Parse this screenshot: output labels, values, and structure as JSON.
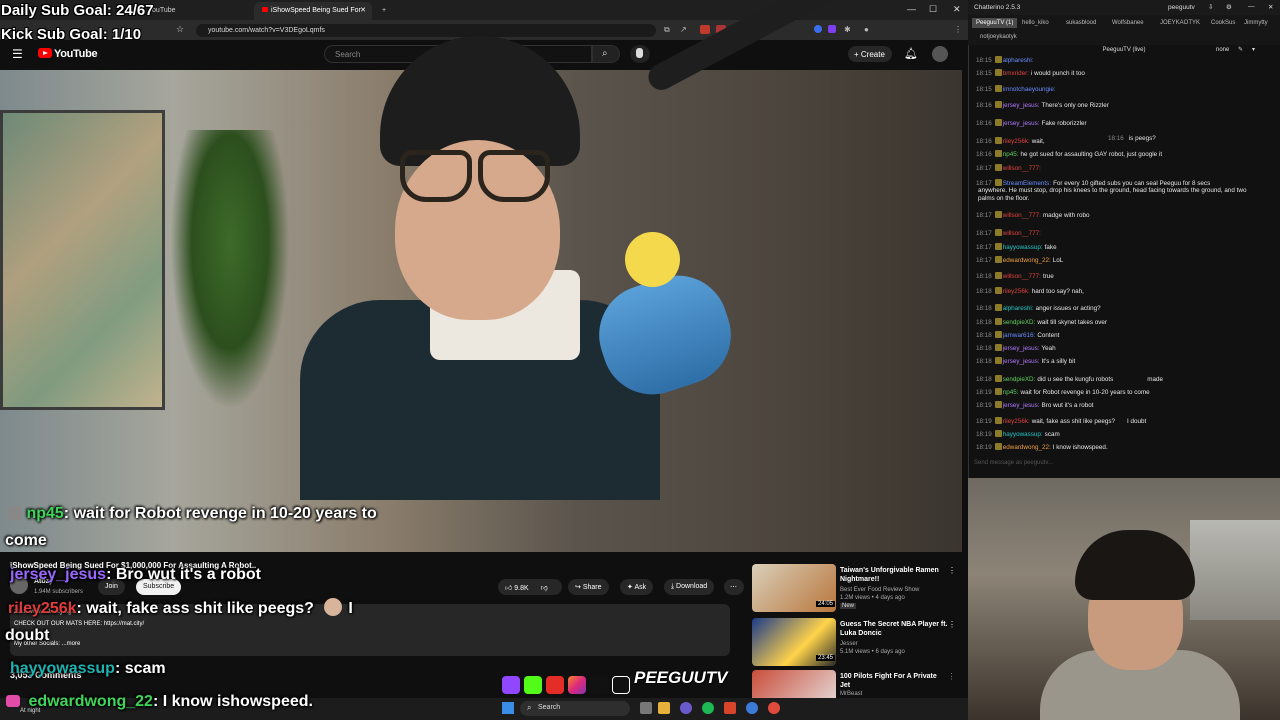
{
  "goals": {
    "daily": "Daily Sub Goal: 24/67",
    "kick": "Kick Sub Goal: 1/10"
  },
  "browser": {
    "tabs": [
      "YouTube",
      "iShowSpeed Being Sued For"
    ],
    "url": "youtube.com/watch?v=V3DEgoLqmfs",
    "window_controls": [
      "—",
      "☐",
      "✕"
    ]
  },
  "youtube": {
    "logo": "YouTube",
    "search_placeholder": "Search",
    "create_label": "Create",
    "video_title": "iShowSpeed Being Sued For $1,000,000 For Assaulting A Robot..",
    "channel": "Atozy",
    "subscribers": "1.94M subscribers",
    "join_label": "Join",
    "subscribe_label": "Subscribe",
    "likes": "9.8K",
    "share_label": "Share",
    "ask_label": "Ask",
    "download_label": "Download",
    "desc_views": "211K views  1 day ago",
    "desc_line": "CHECK OUT OUR MATS HERE: https://mat.city/",
    "desc_more": "My other Socials:  ...more",
    "comments": "3,053 Comments",
    "recommended": [
      {
        "title": "Taiwan's Unforgivable Ramen Nightmare!!",
        "channel": "Best Ever Food Review Show",
        "meta": "1.2M views • 4 days ago",
        "badge": "New",
        "duration": "24:05"
      },
      {
        "title": "Guess The Secret NBA Player ft. Luka Doncic",
        "channel": "Jesser",
        "meta": "5.1M views • 6 days ago",
        "duration": "23:45"
      },
      {
        "title": "100 Pilots Fight For A Private Jet",
        "channel": "MrBeast",
        "meta": "",
        "duration": ""
      }
    ]
  },
  "overlay_chat": [
    {
      "user": "np45",
      "msg": ": wait for Robot revenge in 10-20 years to",
      "cont": "come"
    },
    {
      "user": "jersey_jesus",
      "msg": ": Bro wut it's a robot"
    },
    {
      "user": "riley256k",
      "msg": ": wait, fake ass shit like peegs?",
      "cont": "doubt",
      "tail": "I"
    },
    {
      "user": "hayyowassup",
      "msg": ": scam"
    },
    {
      "user": "edwardwong_22",
      "msg": ": I know ishowspeed."
    }
  ],
  "taskbar": {
    "search": "Search",
    "left_text": "At night"
  },
  "chatterino": {
    "title": "Chatterino 2.5.3",
    "account": "peeguutv",
    "tabs": [
      "PeeguuTV (1)",
      "hello_kiko",
      "sukasblood",
      "Wolfsbanee",
      "JOEYKAOTYK",
      "CookSus",
      "Jimmytty",
      "notjoeykaotyk"
    ],
    "channel_header": "PeeguuTV (live)",
    "mode": "none",
    "input_placeholder": "Send message as peeguutv...",
    "messages": [
      {
        "time": "18:15",
        "user": "alphareshi:",
        "text": "",
        "color": "n-blue"
      },
      {
        "time": "18:15",
        "user": "bmxrider:",
        "text": "i would punch it too",
        "color": "n-red"
      },
      {
        "time": "18:15",
        "user": "imnotchaeyoungie:",
        "text": "",
        "color": "n-blue"
      },
      {
        "time": "18:16",
        "user": "jersey_jesus:",
        "text": "There's only one Rizzler",
        "color": "n-purple"
      },
      {
        "time": "18:16",
        "user": "jersey_jesus:",
        "text": "Fake roborizzler",
        "color": "n-purple"
      },
      {
        "time": "18:16",
        "user": "riley256k:",
        "text": "wait,",
        "color": "n-red"
      },
      {
        "time": "18:16",
        "user": "",
        "text": "is peegs?",
        "color": "n-red"
      },
      {
        "time": "18:16",
        "user": "np45:",
        "text": "he got sued for assaulting GAY robot, just google it",
        "color": "n-green"
      },
      {
        "time": "18:17",
        "user": "willson__777:",
        "text": "",
        "color": "n-red"
      },
      {
        "time": "18:17",
        "user": "StreamElements:",
        "text": "For every 10 gifted subs you can seal Peeguu for 8 secs",
        "color": "n-blue"
      },
      {
        "time": "",
        "user": "",
        "text": "anywhere. He must stop, drop his knees to the ground, head facing towards the ground, and two",
        "color": ""
      },
      {
        "time": "",
        "user": "",
        "text": "palms on the floor.",
        "color": ""
      },
      {
        "time": "18:17",
        "user": "willson__777:",
        "text": "madge with robo",
        "color": "n-red"
      },
      {
        "time": "18:17",
        "user": "willson__777:",
        "text": "",
        "color": "n-red"
      },
      {
        "time": "18:17",
        "user": "hayyowassup:",
        "text": "fake",
        "color": "n-cyan"
      },
      {
        "time": "18:17",
        "user": "edwardwong_22:",
        "text": "LoL",
        "color": "n-orange"
      },
      {
        "time": "18:18",
        "user": "willson__777:",
        "text": "true",
        "color": "n-red"
      },
      {
        "time": "18:18",
        "user": "riley256k:",
        "text": "hard too say? nah,",
        "color": "n-red"
      },
      {
        "time": "18:18",
        "user": "alphareshi:",
        "text": "anger issues or acting?",
        "color": "n-cyan"
      },
      {
        "time": "18:18",
        "user": "sendpieXD:",
        "text": "wait till skynet takes over",
        "color": "n-green"
      },
      {
        "time": "18:18",
        "user": "jamwar616:",
        "text": "Content",
        "color": "n-blue"
      },
      {
        "time": "18:18",
        "user": "jersey_jesus:",
        "text": "Yeah",
        "color": "n-purple"
      },
      {
        "time": "18:18",
        "user": "jersey_jesus:",
        "text": "It's a silly bit",
        "color": "n-purple"
      },
      {
        "time": "18:18",
        "user": "sendpieXD:",
        "text": "did u see the kungfu robots",
        "color": "n-green"
      },
      {
        "time": "18:19",
        "user": "np45:",
        "text": "wait for Robot revenge in 10-20 years to come",
        "color": "n-green"
      },
      {
        "time": "18:19",
        "user": "jersey_jesus:",
        "text": "Bro wut it's a robot",
        "color": "n-purple"
      },
      {
        "time": "18:19",
        "user": "riley256k:",
        "text": "wait, fake ass shit like peegs?",
        "color": "n-red"
      },
      {
        "time": "18:19",
        "user": "hayyowassup:",
        "text": "scam",
        "color": "n-cyan"
      },
      {
        "time": "18:19",
        "user": "edwardwong_22:",
        "text": "I know ishowspeed.",
        "color": "n-orange"
      }
    ],
    "made_suffix": "made",
    "i_doubt": "I doubt"
  },
  "logo_text": "PEEGUUTV"
}
